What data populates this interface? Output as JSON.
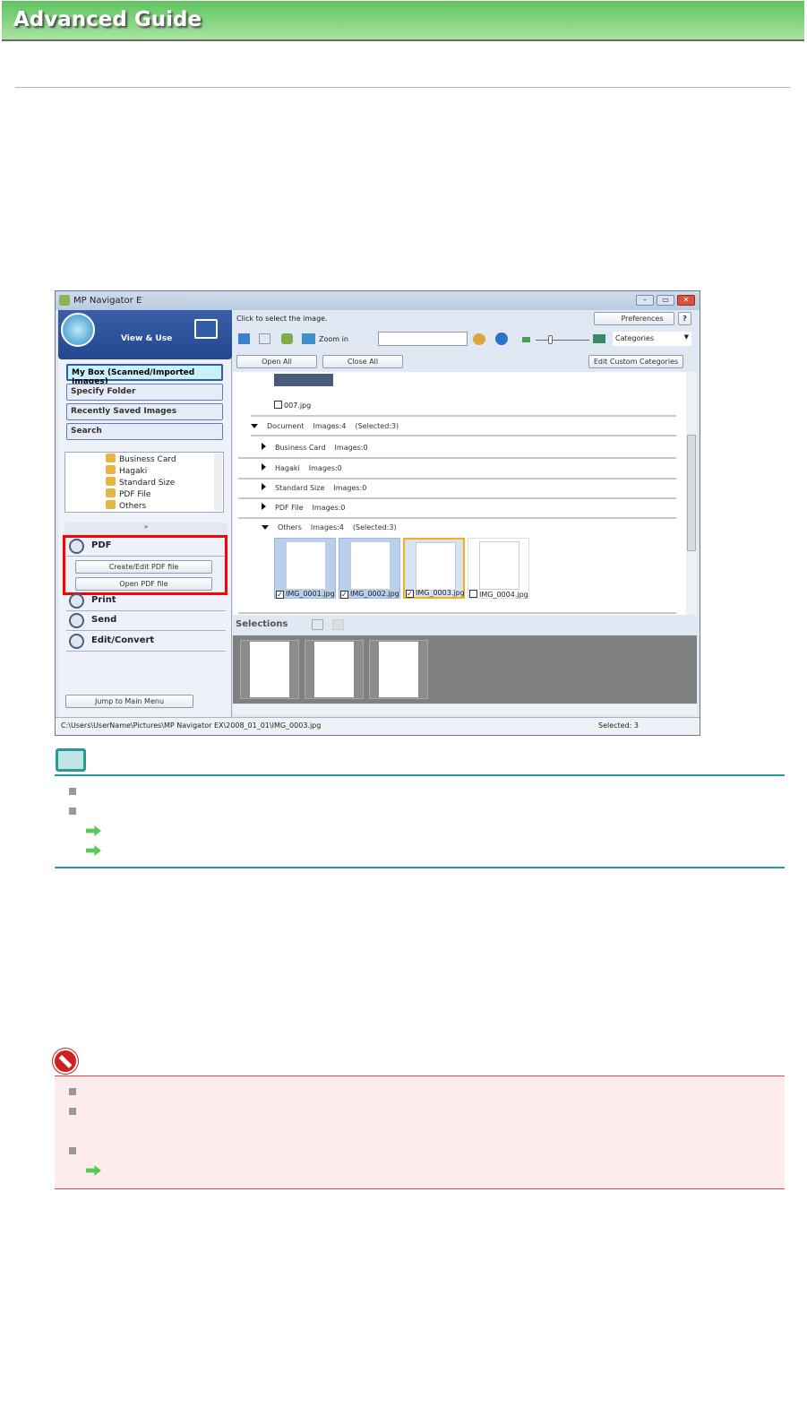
{
  "banner": {
    "title": "Advanced Guide"
  },
  "window": {
    "title": "MP Navigator EX",
    "controls": {
      "minimize": "–",
      "maximize": "▭",
      "close": "✕"
    },
    "left": {
      "mode_label": "View & Use",
      "nav": [
        "My Box (Scanned/Imported Images)",
        "Specify Folder",
        "Recently Saved Images",
        "Search"
      ],
      "tree": [
        "Business Card",
        "Hagaki",
        "Standard Size",
        "PDF File",
        "Others"
      ],
      "chevron": "»",
      "actions": {
        "pdf": "PDF",
        "create_edit": "Create/Edit PDF file",
        "open_pdf": "Open PDF file",
        "print": "Print",
        "send": "Send",
        "edit_convert": "Edit/Convert"
      },
      "jump": "Jump to Main Menu"
    },
    "right": {
      "instruction": "Click to select the image.",
      "preferences": "Preferences",
      "help": "?",
      "zoom_in": "Zoom in",
      "search_value": "",
      "view_select": "Categories",
      "open_all": "Open All",
      "close_all": "Close All",
      "edit_custom": "Edit Custom Categories",
      "top_image": "007.jpg",
      "document": {
        "name": "Document",
        "images": "Images:4",
        "selected": "(Selected:3)"
      },
      "subcats": [
        {
          "name": "Business Card",
          "images": "Images:0"
        },
        {
          "name": "Hagaki",
          "images": "Images:0"
        },
        {
          "name": "Standard Size",
          "images": "Images:0"
        },
        {
          "name": "PDF File",
          "images": "Images:0"
        }
      ],
      "others": {
        "name": "Others",
        "images": "Images:4",
        "selected": "(Selected:3)"
      },
      "thumbs": [
        {
          "name": "IMG_0001.jpg",
          "checked": true
        },
        {
          "name": "IMG_0002.jpg",
          "checked": true
        },
        {
          "name": "IMG_0003.jpg",
          "checked": true
        },
        {
          "name": "IMG_0004.jpg",
          "checked": false
        }
      ],
      "selections_label": "Selections"
    },
    "status": {
      "path": "C:\\Users\\UserName\\Pictures\\MP Navigator EX\\2008_01_01\\IMG_0003.jpg",
      "selected": "Selected: 3"
    }
  }
}
